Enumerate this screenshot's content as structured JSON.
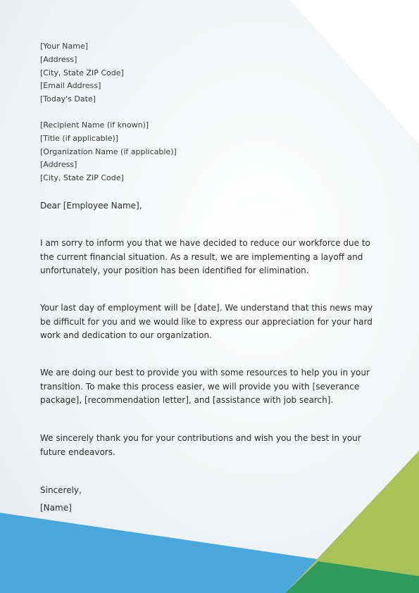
{
  "sender": {
    "name": "[Your Name]",
    "address": "[Address]",
    "city_state_zip": "[City, State ZIP Code]",
    "email": "[Email Address]",
    "date": "[Today's Date]"
  },
  "recipient": {
    "name": "[Recipient Name (if known)]",
    "title": "[Title (if applicable)]",
    "organization": "[Organization Name (if applicable)]",
    "address": "[Address]",
    "city_state_zip": "[City, State ZIP Code]"
  },
  "salutation": "Dear [Employee Name],",
  "paragraphs": [
    "I am sorry to inform you that we have decided to reduce our workforce due to the current financial situation. As a result, we are implementing a layoff and unfortunately, your position has been identified for elimination.",
    "Your last day of employment will be [date]. We understand that this news may be difficult for you and we would like to express our appreciation for your hard work and dedication to our organization.",
    "We are doing our best to provide you with some resources to help you in your transition. To make this process easier, we will provide you with [severance package], [recommendation letter], and [assistance with job search].",
    "We sincerely thank you for your contributions and wish you the best in your future endeavors."
  ],
  "closing": "Sincerely,",
  "signature": "[Name]",
  "colors": {
    "blue": "#4aa8dc",
    "lime": "#a8c256",
    "green": "#2f9a5c",
    "white_panel": "#ffffff"
  }
}
